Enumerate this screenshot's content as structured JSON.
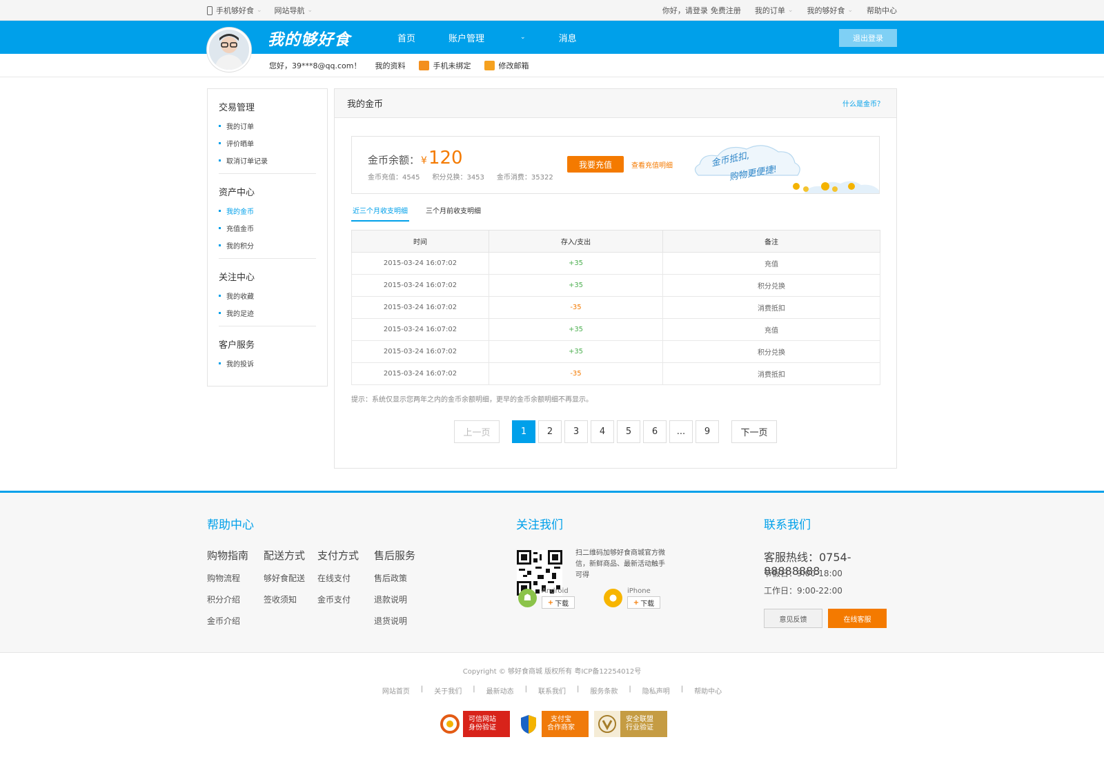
{
  "topbar": {
    "mobile": "手机够好食",
    "site_nav": "网站导航",
    "greeting": "你好，请登录",
    "register": "免费注册",
    "my_orders": "我的订单",
    "my_site": "我的够好食",
    "help": "帮助中心"
  },
  "header": {
    "logo": "我的够好食",
    "nav": [
      "首页",
      "账户管理",
      "消息"
    ],
    "logout": "退出登录"
  },
  "subbar": {
    "hello": "您好，39***8@qq.com！",
    "profile": "我的资料",
    "phone": "手机未绑定",
    "email": "修改邮箱"
  },
  "sidebar": {
    "groups": [
      {
        "title": "交易管理",
        "items": [
          "我的订单",
          "评价晒单",
          "取消订单记录"
        ]
      },
      {
        "title": "资产中心",
        "items": [
          "我的金币",
          "充值金币",
          "我的积分"
        ]
      },
      {
        "title": "关注中心",
        "items": [
          "我的收藏",
          "我的足迹"
        ]
      },
      {
        "title": "客户服务",
        "items": [
          "我的投诉"
        ]
      }
    ]
  },
  "content": {
    "title": "我的金币",
    "what_link": "什么是金币？",
    "balance_label": "金币余额：",
    "yen": "¥",
    "balance": "120",
    "stat_recharge": "金币充值：4545",
    "stat_exchange": "积分兑换：3453",
    "stat_spend": "金币消费：35322",
    "recharge_btn": "我要充值",
    "detail_link": "查看充值明细",
    "cloud_text_1": "金币抵扣,",
    "cloud_text_2": "购物更便捷!",
    "tabs": [
      "近三个月收支明细",
      "三个月前收支明细"
    ],
    "columns": [
      "时间",
      "存入/支出",
      "备注"
    ],
    "rows": [
      {
        "time": "2015-03-24 16:07:02",
        "amount": "+35",
        "note": "充值"
      },
      {
        "time": "2015-03-24 16:07:02",
        "amount": "+35",
        "note": "积分兑换"
      },
      {
        "time": "2015-03-24 16:07:02",
        "amount": "-35",
        "note": "消费抵扣"
      },
      {
        "time": "2015-03-24 16:07:02",
        "amount": "+35",
        "note": "充值"
      },
      {
        "time": "2015-03-24 16:07:02",
        "amount": "+35",
        "note": "积分兑换"
      },
      {
        "time": "2015-03-24 16:07:02",
        "amount": "-35",
        "note": "消费抵扣"
      }
    ],
    "tip": "提示：系统仅显示您两年之内的金币余额明细，更早的金币余额明细不再显示。",
    "pager": {
      "prev": "上一页",
      "pages": [
        "1",
        "2",
        "3",
        "4",
        "5",
        "6",
        "...",
        "9"
      ],
      "next": "下一页",
      "current": "1"
    }
  },
  "footer": {
    "help_title": "帮助中心",
    "help_headers": [
      "购物指南",
      "配送方式",
      "支付方式",
      "售后服务"
    ],
    "help_rows": [
      [
        "购物流程",
        "够好食配送",
        "在线支付",
        "售后政策"
      ],
      [
        "积分介绍",
        "签收须知",
        "金币支付",
        "退款说明"
      ],
      [
        "金币介绍",
        "",
        "",
        "退货说明"
      ]
    ],
    "follow_title": "关注我们",
    "qr_text": "扫二维码加够好食商城官方微信，新鲜商品、最新活动触手可得",
    "android": "Android",
    "iphone": "iPhone",
    "download": "下载",
    "contact_title": "联系我们",
    "hotline": "客服热线：0754-88888888",
    "holiday": "节假日：9:00-18:00",
    "workday": "工作日：9:00-22:00",
    "feedback": "意见反馈",
    "online_service": "在线客服",
    "copyright": "Copyright © 够好食商城 版权所有 粤ICP备12254012号",
    "links": [
      "网站首页",
      "关于我们",
      "最新动态",
      "联系我们",
      "服务条款",
      "隐私声明",
      "帮助中心"
    ],
    "badges": [
      {
        "l1": "可信网站",
        "l2": "身份验证"
      },
      {
        "l1": "支付宝",
        "l2": "合作商家"
      },
      {
        "l1": "安全联盟",
        "l2": "行业验证"
      }
    ]
  },
  "colors": {
    "brand": "#00a0ea",
    "accent": "#f47a00",
    "positive": "#4caf50"
  }
}
